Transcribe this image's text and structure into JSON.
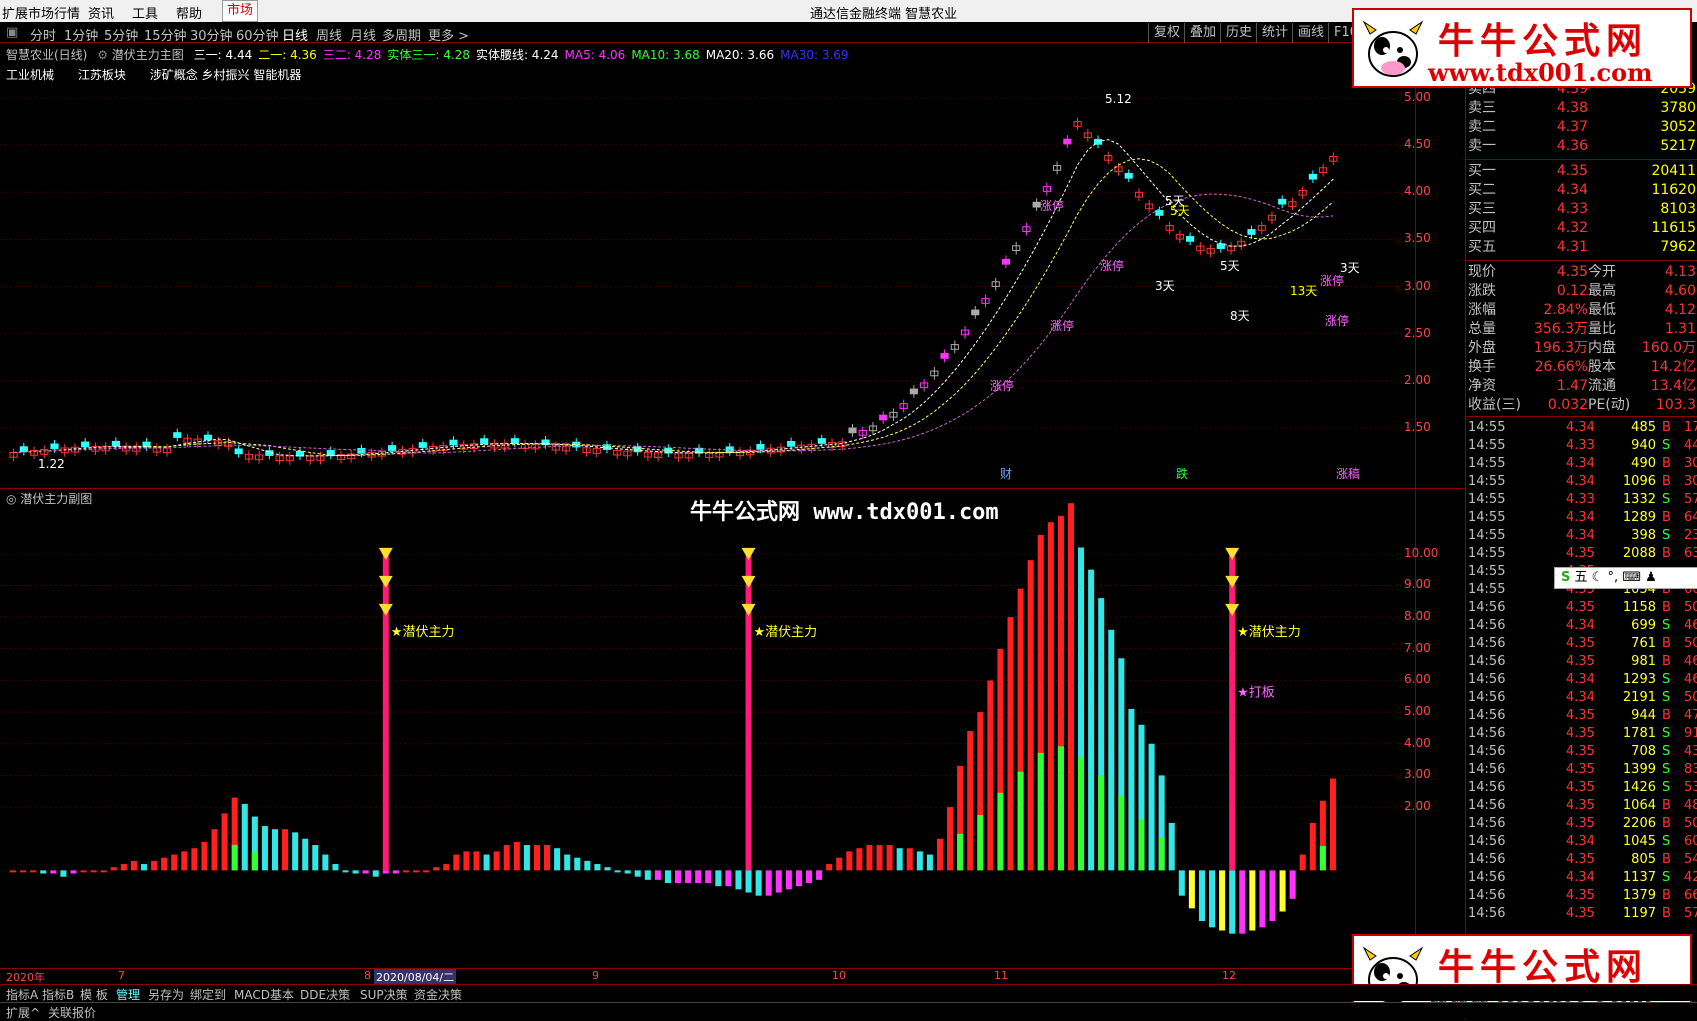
{
  "menubar": {
    "items": [
      "扩展市场行情",
      "资讯",
      "工具",
      "帮助"
    ],
    "market_tab": "市场",
    "title": "通达信金融终端  智慧农业"
  },
  "toolbar": {
    "periods": [
      "分时",
      "1分钟",
      "5分钟",
      "15分钟",
      "30分钟",
      "60分钟",
      "日线",
      "周线",
      "月线",
      "多周期",
      "更多 >"
    ],
    "active": "日线",
    "right_tools": [
      "复权",
      "叠加",
      "历史",
      "统计",
      "画线",
      "F10"
    ]
  },
  "info": {
    "stock": "智慧农业(日线)",
    "indicator": "潜伏主力主图",
    "items": [
      {
        "label": "三一: 4.44",
        "color": "#ffffff"
      },
      {
        "label": "二一: 4.36",
        "color": "#ffff00"
      },
      {
        "label": "三二: 4.28",
        "color": "#ff33ff"
      },
      {
        "label": "实体三一: 4.28",
        "color": "#33ff33"
      },
      {
        "label": "实体腰线: 4.24",
        "color": "#ffffff"
      },
      {
        "label": "MA5: 4.06",
        "color": "#ff33ff"
      },
      {
        "label": "MA10: 3.68",
        "color": "#33ff33"
      },
      {
        "label": "MA20: 3.66",
        "color": "#ffffff"
      },
      {
        "label": "MA30: 3.69",
        "color": "#3333ff"
      }
    ],
    "concepts": [
      "工业机械",
      "江苏板块",
      "涉矿概念 乡村振兴 智能机器"
    ]
  },
  "main_chart": {
    "y_labels": [
      "5.00",
      "4.50",
      "4.00",
      "3.50",
      "3.00",
      "2.50",
      "2.00",
      "1.50"
    ],
    "high_label": "5.12",
    "low_label": "1.22",
    "markers": [
      "涨停",
      "3天",
      "5天",
      "13天",
      "8天",
      "财",
      "跌",
      "涨稿"
    ]
  },
  "chart_data": {
    "type": "bar",
    "title": "潜伏主力副图",
    "x_labels": [
      "2020年",
      "7",
      "8",
      "2020/08/04/二",
      "9",
      "10",
      "11",
      "12"
    ],
    "y_labels": [
      "10.00",
      "9.00",
      "8.00",
      "7.00",
      "6.00",
      "5.00",
      "4.00",
      "3.00",
      "2.00"
    ],
    "ylim": [
      -2.2,
      11.7
    ],
    "annotation_texts": [
      "潜伏主力",
      "潜伏主力",
      "潜伏主力",
      "打板"
    ],
    "spikes": [
      {
        "value": 10.0
      },
      {
        "value": 10.0
      },
      {
        "value": 10.0
      }
    ],
    "series": [
      {
        "values": [
          0.0,
          0.0,
          0.0,
          -0.1,
          -0.1,
          -0.2,
          -0.1,
          0.0,
          0.0,
          0.0,
          0.1,
          0.2,
          0.3,
          0.2,
          0.3,
          0.4,
          0.5,
          0.6,
          0.7,
          0.9,
          1.3,
          1.8,
          2.3,
          2.1,
          1.7,
          1.4,
          1.3,
          1.3,
          1.2,
          1.0,
          0.8,
          0.5,
          0.2,
          0.0,
          -0.1,
          -0.1,
          -0.2,
          -0.1,
          -0.1,
          0.0,
          0.0,
          0.0,
          0.1,
          0.2,
          0.5,
          0.6,
          0.6,
          0.5,
          0.6,
          0.8,
          0.9,
          0.8,
          0.8,
          0.8,
          0.7,
          0.5,
          0.4,
          0.3,
          0.2,
          0.1,
          0.0,
          -0.1,
          -0.2,
          -0.3,
          -0.3,
          -0.4,
          -0.4,
          -0.4,
          -0.4,
          -0.4,
          -0.5,
          -0.5,
          -0.6,
          -0.7,
          -0.8,
          -0.8,
          -0.7,
          -0.6,
          -0.5,
          -0.4,
          -0.3,
          0.2,
          0.4,
          0.6,
          0.7,
          0.8,
          0.8,
          0.8,
          0.7,
          0.7,
          0.6,
          0.5,
          1.0,
          2.0,
          3.3,
          4.4,
          5.0,
          6.0,
          7.0,
          8.0,
          8.9,
          9.8,
          10.6,
          11.0,
          11.2,
          11.6,
          10.2,
          9.5,
          8.6,
          7.6,
          6.7,
          5.1,
          4.6,
          4.0,
          3.0,
          1.5,
          -0.8,
          -1.2,
          -1.6,
          -1.8,
          -1.9,
          -2.0,
          -2.0,
          -1.9,
          -1.8,
          -1.6,
          -1.3,
          -0.9,
          0.5,
          1.5,
          2.2,
          2.9
        ]
      }
    ]
  },
  "order_book": {
    "sell": [
      {
        "label": "卖四",
        "price": "4.39",
        "vol": "2039"
      },
      {
        "label": "卖三",
        "price": "4.38",
        "vol": "3780"
      },
      {
        "label": "卖二",
        "price": "4.37",
        "vol": "3052"
      },
      {
        "label": "卖一",
        "price": "4.36",
        "vol": "5217"
      }
    ],
    "buy": [
      {
        "label": "买一",
        "price": "4.35",
        "vol": "20411"
      },
      {
        "label": "买二",
        "price": "4.34",
        "vol": "11620"
      },
      {
        "label": "买三",
        "price": "4.33",
        "vol": "8103"
      },
      {
        "label": "买四",
        "price": "4.32",
        "vol": "11615"
      },
      {
        "label": "买五",
        "price": "4.31",
        "vol": "7962"
      }
    ]
  },
  "quote": [
    {
      "k1": "现价",
      "v1": "4.35",
      "k2": "今开",
      "v2": "4.13"
    },
    {
      "k1": "涨跌",
      "v1": "0.12",
      "k2": "最高",
      "v2": "4.60"
    },
    {
      "k1": "涨幅",
      "v1": "2.84%",
      "k2": "最低",
      "v2": "4.12"
    },
    {
      "k1": "总量",
      "v1": "356.3万",
      "k2": "量比",
      "v2": "1.31"
    },
    {
      "k1": "外盘",
      "v1": "196.3万",
      "k2": "内盘",
      "v2": "160.0万"
    },
    {
      "k1": "换手",
      "v1": "26.66%",
      "k2": "股本",
      "v2": "14.2亿"
    },
    {
      "k1": "净资",
      "v1": "1.47",
      "k2": "流通",
      "v2": "13.4亿"
    },
    {
      "k1": "收益(三)",
      "v1": "0.032",
      "k2": "PE(动)",
      "v2": "103.3"
    }
  ],
  "ticks": [
    {
      "t": "14:55",
      "p": "4.34",
      "v": "485",
      "d": "B",
      "n": "17"
    },
    {
      "t": "14:55",
      "p": "4.33",
      "v": "940",
      "d": "S",
      "n": "44"
    },
    {
      "t": "14:55",
      "p": "4.34",
      "v": "490",
      "d": "B",
      "n": "30"
    },
    {
      "t": "14:55",
      "p": "4.34",
      "v": "1096",
      "d": "B",
      "n": "30"
    },
    {
      "t": "14:55",
      "p": "4.33",
      "v": "1332",
      "d": "S",
      "n": "57"
    },
    {
      "t": "14:55",
      "p": "4.34",
      "v": "1289",
      "d": "B",
      "n": "64"
    },
    {
      "t": "14:55",
      "p": "4.34",
      "v": "398",
      "d": "S",
      "n": "23"
    },
    {
      "t": "14:55",
      "p": "4.35",
      "v": "2088",
      "d": "B",
      "n": "63"
    },
    {
      "t": "14:55",
      "p": "4.35",
      "v": "",
      "d": "",
      "n": ""
    },
    {
      "t": "14:55",
      "p": "4.35",
      "v": "1054",
      "d": "B",
      "n": "60"
    },
    {
      "t": "14:56",
      "p": "4.35",
      "v": "1158",
      "d": "B",
      "n": "50"
    },
    {
      "t": "14:56",
      "p": "4.34",
      "v": "699",
      "d": "S",
      "n": "46"
    },
    {
      "t": "14:56",
      "p": "4.35",
      "v": "761",
      "d": "B",
      "n": "50"
    },
    {
      "t": "14:56",
      "p": "4.35",
      "v": "981",
      "d": "B",
      "n": "46"
    },
    {
      "t": "14:56",
      "p": "4.34",
      "v": "1293",
      "d": "S",
      "n": "46"
    },
    {
      "t": "14:56",
      "p": "4.34",
      "v": "2191",
      "d": "S",
      "n": "50"
    },
    {
      "t": "14:56",
      "p": "4.35",
      "v": "944",
      "d": "B",
      "n": "47"
    },
    {
      "t": "14:56",
      "p": "4.35",
      "v": "1781",
      "d": "S",
      "n": "91"
    },
    {
      "t": "14:56",
      "p": "4.35",
      "v": "708",
      "d": "S",
      "n": "43"
    },
    {
      "t": "14:56",
      "p": "4.35",
      "v": "1399",
      "d": "S",
      "n": "83"
    },
    {
      "t": "14:56",
      "p": "4.35",
      "v": "1426",
      "d": "S",
      "n": "53"
    },
    {
      "t": "14:56",
      "p": "4.35",
      "v": "1064",
      "d": "B",
      "n": "48"
    },
    {
      "t": "14:56",
      "p": "4.35",
      "v": "2206",
      "d": "B",
      "n": "50"
    },
    {
      "t": "14:56",
      "p": "4.34",
      "v": "1045",
      "d": "S",
      "n": "60"
    },
    {
      "t": "14:56",
      "p": "4.35",
      "v": "805",
      "d": "B",
      "n": "54"
    },
    {
      "t": "14:56",
      "p": "4.34",
      "v": "1137",
      "d": "S",
      "n": "42"
    },
    {
      "t": "14:56",
      "p": "4.35",
      "v": "1379",
      "d": "B",
      "n": "66"
    },
    {
      "t": "14:56",
      "p": "4.35",
      "v": "1197",
      "d": "B",
      "n": "57"
    }
  ],
  "bottom_tabs": [
    "指标A",
    "指标B",
    "模 板",
    "管理",
    "另存为",
    "绑定到",
    "MACD基本",
    "DDE决策",
    "SUP决策",
    "资金决策"
  ],
  "status": [
    "扩展^",
    "关联报价"
  ],
  "watermark": {
    "name": "牛牛公式网",
    "url": "www.tdx001.com",
    "center": "牛牛公式网 www.tdx001.com"
  },
  "ime": "五"
}
